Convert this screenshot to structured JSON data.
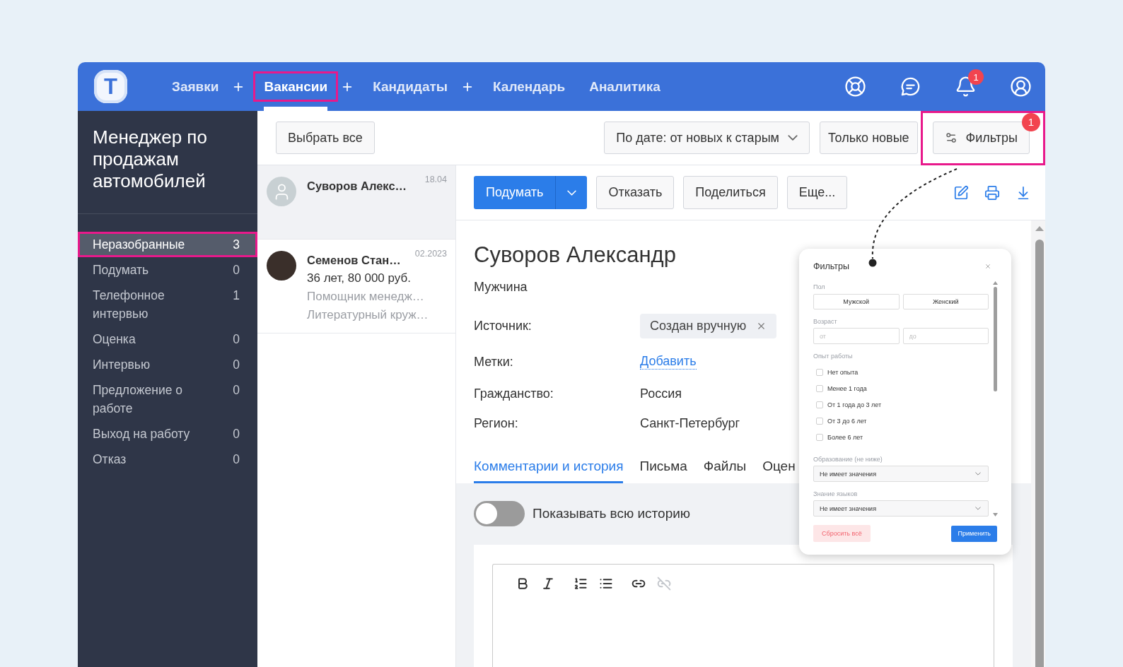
{
  "header": {
    "logo": "T",
    "nav": [
      {
        "label": "Заявки",
        "selected": false,
        "highlighted": false,
        "add_button": true
      },
      {
        "label": "Вакансии",
        "selected": true,
        "highlighted": true,
        "add_button": true
      },
      {
        "label": "Кандидаты",
        "selected": false,
        "highlighted": false,
        "add_button": true
      },
      {
        "label": "Календарь",
        "selected": false,
        "highlighted": false,
        "add_button": false
      },
      {
        "label": "Аналитика",
        "selected": false,
        "highlighted": false,
        "add_button": false
      }
    ],
    "icons": [
      {
        "kind": "support"
      },
      {
        "kind": "chat"
      },
      {
        "kind": "notifications",
        "badge": "1"
      },
      {
        "kind": "profile"
      }
    ]
  },
  "sidebar": {
    "title": "Менеджер по продажам автомобилей",
    "stages": [
      {
        "label": "Неразобранные",
        "count": "3",
        "selected": true,
        "highlighted": true
      },
      {
        "label": "Подумать",
        "count": "0",
        "selected": false,
        "highlighted": false
      },
      {
        "label": "Телефонное интервью",
        "count": "1",
        "selected": false,
        "highlighted": false
      },
      {
        "label": "Оценка",
        "count": "0",
        "selected": false,
        "highlighted": false
      },
      {
        "label": "Интервью",
        "count": "0",
        "selected": false,
        "highlighted": false
      },
      {
        "label": "Предложение о работе",
        "count": "0",
        "selected": false,
        "highlighted": false
      },
      {
        "label": "Выход на работу",
        "count": "0",
        "selected": false,
        "highlighted": false
      },
      {
        "label": "Отказ",
        "count": "0",
        "selected": false,
        "highlighted": false
      }
    ]
  },
  "toolbar": {
    "select_all": "Выбрать все",
    "sort": "По дате: от новых к старым",
    "only_new": "Только новые",
    "filters": {
      "label": "Фильтры",
      "badge": "1",
      "highlighted": true
    }
  },
  "candidates": [
    {
      "kind": "placeholder",
      "name": "Суворов Алекс…",
      "date": "18.04",
      "selected": true
    },
    {
      "kind": "photo",
      "name": "Семенов Стан…",
      "date": "02.2023",
      "selected": false,
      "summary": "36 лет, 80 000 руб.",
      "details": [
        "Помощник менедж…",
        "Литературный круж…"
      ]
    }
  ],
  "actions": {
    "primary": "Подумать",
    "buttons": [
      "Отказать",
      "Поделиться",
      "Еще..."
    ],
    "tools": [
      {
        "kind": "edit"
      },
      {
        "kind": "print"
      },
      {
        "kind": "download"
      }
    ]
  },
  "candidate": {
    "name": "Суворов Александр",
    "gender": "Мужчина",
    "fields": [
      {
        "label": "Источник:",
        "kind": "tag",
        "value": "Создан вручную"
      },
      {
        "label": "Метки:",
        "kind": "link",
        "value": "Добавить"
      },
      {
        "label": "Гражданство:",
        "kind": "text",
        "value": "Россия"
      },
      {
        "label": "Регион:",
        "kind": "text",
        "value": "Санкт-Петербург"
      }
    ]
  },
  "tabs": [
    {
      "label": "Комментарии и история",
      "selected": true
    },
    {
      "label": "Письма",
      "selected": false
    },
    {
      "label": "Файлы",
      "selected": false
    },
    {
      "label": "Оцен",
      "selected": false
    }
  ],
  "history": {
    "label": "Показывать всю историю",
    "on": false
  },
  "editor": {
    "tools": [
      {
        "kind": "bold",
        "disabled": false
      },
      {
        "kind": "italic",
        "disabled": false
      },
      {
        "kind": "ordered_list",
        "disabled": false
      },
      {
        "kind": "bullet_list",
        "disabled": false
      },
      {
        "kind": "link",
        "disabled": false
      },
      {
        "kind": "unlink",
        "disabled": true
      }
    ]
  },
  "filters_popup": {
    "title": "Фильтры",
    "gender": {
      "label": "Пол",
      "options": [
        {
          "label": "Мужской",
          "selected": false
        },
        {
          "label": "Женский",
          "selected": false
        }
      ]
    },
    "age": {
      "label": "Возраст",
      "from": {
        "placeholder": "от"
      },
      "to": {
        "placeholder": "до"
      }
    },
    "experience": {
      "label": "Опыт работы",
      "options": [
        {
          "label": "Нет опыта",
          "checked": false
        },
        {
          "label": "Менее 1 года",
          "checked": false
        },
        {
          "label": "От 1 года до 3 лет",
          "checked": false
        },
        {
          "label": "От 3 до 6 лет",
          "checked": false
        },
        {
          "label": "Более 6 лет",
          "checked": false
        }
      ]
    },
    "selects": [
      {
        "label": "Образование (не ниже)",
        "value": "Не имеет значения"
      },
      {
        "label": "Знание языков",
        "value": "Не имеет значения"
      }
    ],
    "reset": "Сбросить всё",
    "apply": "Применить"
  }
}
